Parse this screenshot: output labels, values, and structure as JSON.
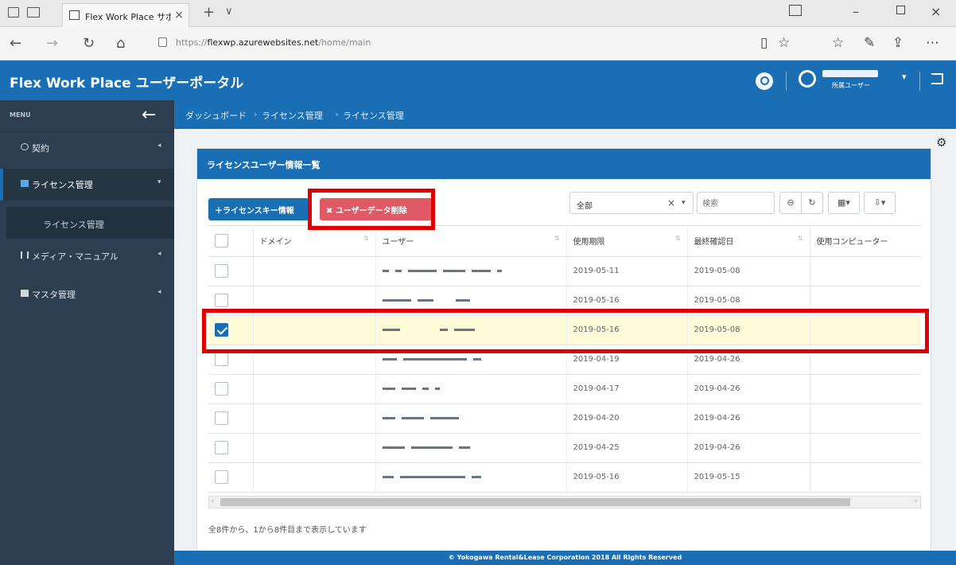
{
  "browser": {
    "tab_title": "Flex Work Place サポート",
    "tab_close": "×",
    "new_tab": "+",
    "tab_list": "∨",
    "url_prefix": "https://",
    "url_host": "flexwp.azurewebsites.net",
    "url_path": "/home/main"
  },
  "app": {
    "title": "Flex Work Place ユーザーポータル",
    "user_role": "所属ユーザー"
  },
  "sidebar": {
    "menu_label": "MENU",
    "items": [
      {
        "label": "契約",
        "arrow": "◂"
      },
      {
        "label": "ライセンス管理",
        "arrow": "▾"
      },
      {
        "label": "メディア・マニュアル",
        "arrow": "◂"
      },
      {
        "label": "マスタ管理",
        "arrow": "◂"
      }
    ],
    "sub_item": "ライセンス管理"
  },
  "breadcrumb": {
    "items": [
      "ダッシュボード",
      "ライセンス管理",
      "ライセンス管理"
    ]
  },
  "panel": {
    "title": "ライセンスユーザー情報一覧",
    "btn_license_key": "＋ライセンスキー情報",
    "btn_delete_user": "✖ ユーザーデータ削除",
    "filter_value": "全部",
    "filter_clear": "×",
    "filter_caret": "▾",
    "search_placeholder": "検索",
    "tools": [
      "⊖",
      "↻",
      "▦▾",
      "⇩▾"
    ]
  },
  "table": {
    "columns": [
      "ドメイン",
      "ユーザー",
      "使用期限",
      "最終確認日",
      "使用コンピューター"
    ],
    "rows": [
      {
        "domain": "",
        "used_until": "2019-05-11",
        "last_checked": "2019-05-08",
        "computer": "",
        "checked": false
      },
      {
        "domain": "",
        "used_until": "2019-05-16",
        "last_checked": "2019-05-08",
        "computer": "",
        "checked": false
      },
      {
        "domain": "",
        "used_until": "2019-05-16",
        "last_checked": "2019-05-08",
        "computer": "",
        "checked": true
      },
      {
        "domain": "",
        "used_until": "2019-04-19",
        "last_checked": "2019-04-26",
        "computer": "",
        "checked": false
      },
      {
        "domain": "",
        "used_until": "2019-04-17",
        "last_checked": "2019-04-26",
        "computer": "",
        "checked": false
      },
      {
        "domain": "",
        "used_until": "2019-04-20",
        "last_checked": "2019-04-26",
        "computer": "",
        "checked": false
      },
      {
        "domain": "",
        "used_until": "2019-04-25",
        "last_checked": "2019-04-26",
        "computer": "",
        "checked": false
      },
      {
        "domain": "",
        "used_until": "2019-05-16",
        "last_checked": "2019-05-15",
        "computer": "",
        "checked": false
      }
    ],
    "page_info": "全8件から、1から8件目まで表示しています"
  },
  "footer": {
    "text": "© Yokogawa Rental&Lease Corporation 2018 All Rights Reserved"
  },
  "colors": {
    "primary": "#1a6fb4",
    "sidebar": "#2d3e50",
    "danger": "#e05a66",
    "highlight_row": "#fdfbd8",
    "annotation": "#e00000"
  }
}
